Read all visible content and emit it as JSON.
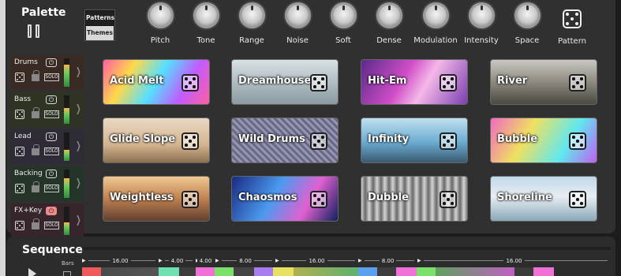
{
  "palette": {
    "title": "Palette",
    "mode_switch": {
      "patterns_label": "Patterns",
      "themes_label": "Themes",
      "selected": "Themes"
    },
    "knobs": [
      {
        "label": "Pitch",
        "icon": "knob"
      },
      {
        "label": "Tone",
        "icon": "knob"
      },
      {
        "label": "Range",
        "icon": "knob"
      },
      {
        "label": "Noise",
        "icon": "knob"
      },
      {
        "label": "Soft",
        "icon": "knob"
      },
      {
        "label": "Dense",
        "icon": "knob"
      },
      {
        "label": "Modulation",
        "icon": "knob"
      },
      {
        "label": "Intensity",
        "icon": "knob"
      },
      {
        "label": "Space",
        "icon": "knob"
      },
      {
        "label": "Pattern",
        "icon": "dice-icon"
      }
    ]
  },
  "tracks": [
    {
      "name": "Drums",
      "power_icon": "⏻",
      "solo": "SOLO",
      "level": 0.78,
      "power_on": false
    },
    {
      "name": "Bass",
      "power_icon": "⏻",
      "solo": "SOLO",
      "level": 0.55,
      "power_on": false
    },
    {
      "name": "Lead",
      "power_icon": "⏻",
      "solo": "SOLO",
      "level": 0.4,
      "power_on": false
    },
    {
      "name": "Backing",
      "power_icon": "⏻",
      "solo": "SOLO",
      "level": 0.7,
      "power_on": false
    },
    {
      "name": "FX+Key",
      "power_icon": "⏻",
      "solo": "SOLO",
      "level": 0.45,
      "power_on": true
    }
  ],
  "themes": [
    {
      "name": "Acid Melt"
    },
    {
      "name": "Dreamhouse"
    },
    {
      "name": "Hit-Em"
    },
    {
      "name": "River"
    },
    {
      "name": "Glide Slope"
    },
    {
      "name": "Wild Drums"
    },
    {
      "name": "Infinity"
    },
    {
      "name": "Bubble"
    },
    {
      "name": "Weightless"
    },
    {
      "name": "Chaosmos"
    },
    {
      "name": "Dubble"
    },
    {
      "name": "Shoreline"
    }
  ],
  "sequence": {
    "title": "Sequence",
    "bars_label": "Bars",
    "segments": [
      {
        "arrow": "▶",
        "length": "16.00"
      },
      {
        "arrow": "▶",
        "length": "4.00"
      },
      {
        "arrow": "▶",
        "length": "4.00"
      },
      {
        "arrow": "▶",
        "length": "8.00"
      },
      {
        "arrow": "▶",
        "length": "16.00"
      },
      {
        "arrow": "▶",
        "length": "8.00"
      },
      {
        "arrow": "▶",
        "length": "16.00"
      }
    ],
    "colors": {
      "red": "#ee5a5a",
      "mint": "#6fe0b0",
      "pink": "#f070d8",
      "green": "#7ae06a",
      "purple": "#a77cf0",
      "yellow": "#e8e060",
      "blue": "#5aa0ee"
    }
  }
}
